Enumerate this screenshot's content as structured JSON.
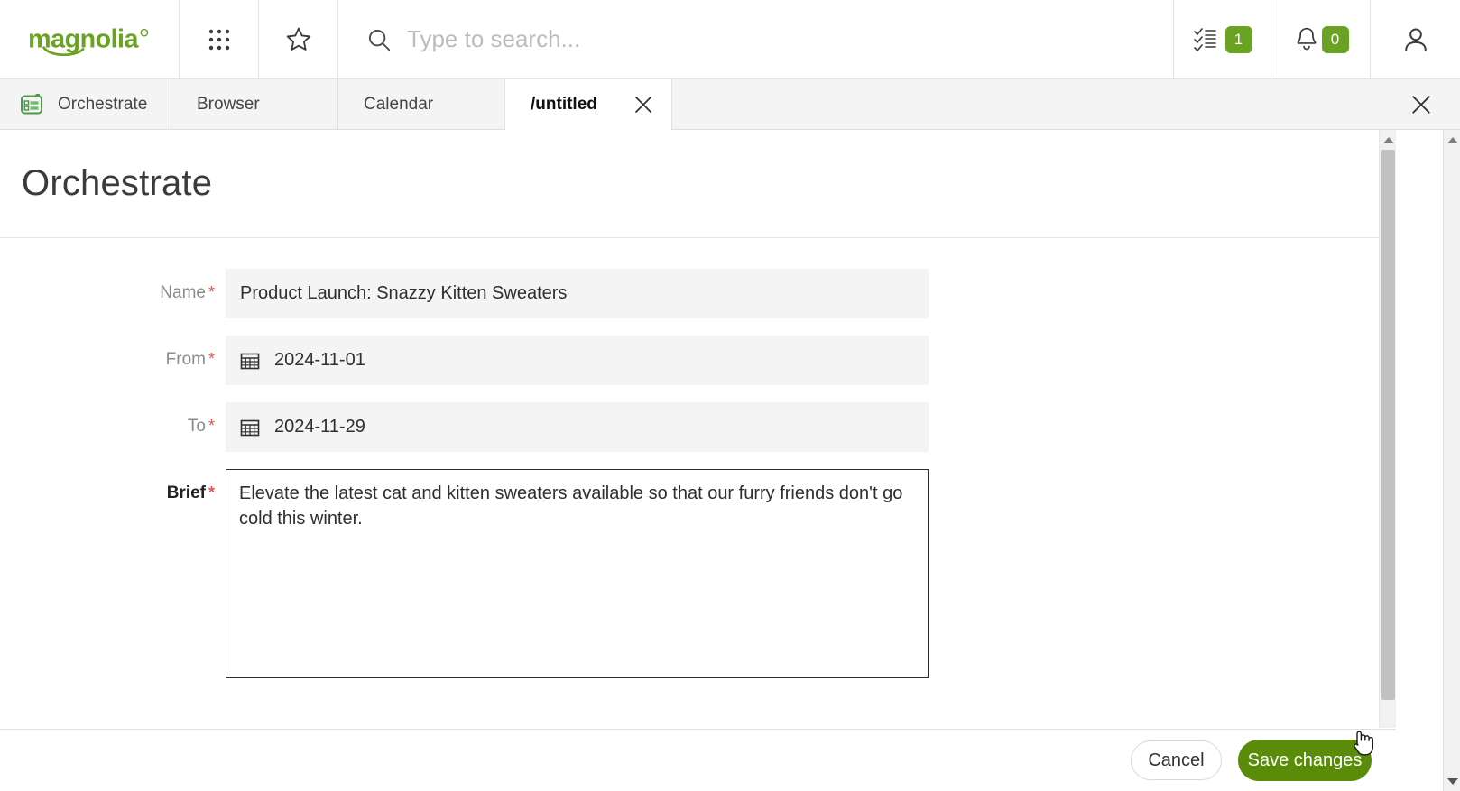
{
  "header": {
    "logo_text": "magnolia",
    "logo_color": "#6aa321",
    "apps_icon": "grid-apps-icon",
    "favorites_icon": "star-icon",
    "search": {
      "placeholder": "Type to search...",
      "value": "",
      "icon": "search-icon"
    },
    "tasks": {
      "icon": "tasks-checklist-icon",
      "badge": "1",
      "badge_color": "#6aa321"
    },
    "notifications": {
      "icon": "bell-icon",
      "badge": "0",
      "badge_color": "#6aa321"
    },
    "user": {
      "icon": "user-avatar-icon"
    }
  },
  "tabs": [
    {
      "label": "Orchestrate",
      "icon": "orchestrate-app-icon",
      "active": false,
      "closable": false
    },
    {
      "label": "Browser",
      "icon": "",
      "active": false,
      "closable": false
    },
    {
      "label": "Calendar",
      "icon": "",
      "active": false,
      "closable": false
    },
    {
      "label": "/untitled",
      "icon": "",
      "active": true,
      "closable": true
    }
  ],
  "tabbar": {
    "close_all_icon": "close-icon"
  },
  "page": {
    "title": "Orchestrate"
  },
  "form": {
    "fields": [
      {
        "label": "Name",
        "required": true,
        "type": "text",
        "value": "Product Launch: Snazzy Kitten Sweaters",
        "placeholder": ""
      },
      {
        "label": "From",
        "required": true,
        "type": "date",
        "value": "2024-11-01",
        "icon": "calendar-icon"
      },
      {
        "label": "To",
        "required": true,
        "type": "date",
        "value": "2024-11-29",
        "icon": "calendar-icon"
      },
      {
        "label": "Brief",
        "required": true,
        "type": "textarea",
        "focused": true,
        "value": "Elevate the latest cat and kitten sweaters available so that our furry friends don't go cold this winter.",
        "placeholder": ""
      }
    ],
    "required_marker": "*"
  },
  "actions": {
    "cancel_label": "Cancel",
    "save_label": "Save changes",
    "save_color": "#5b8c09"
  },
  "scrollbars": {
    "inner_present": true,
    "outer_present": true,
    "up_arrow_icon": "arrow-up-icon",
    "down_arrow_icon": "arrow-down-icon"
  }
}
